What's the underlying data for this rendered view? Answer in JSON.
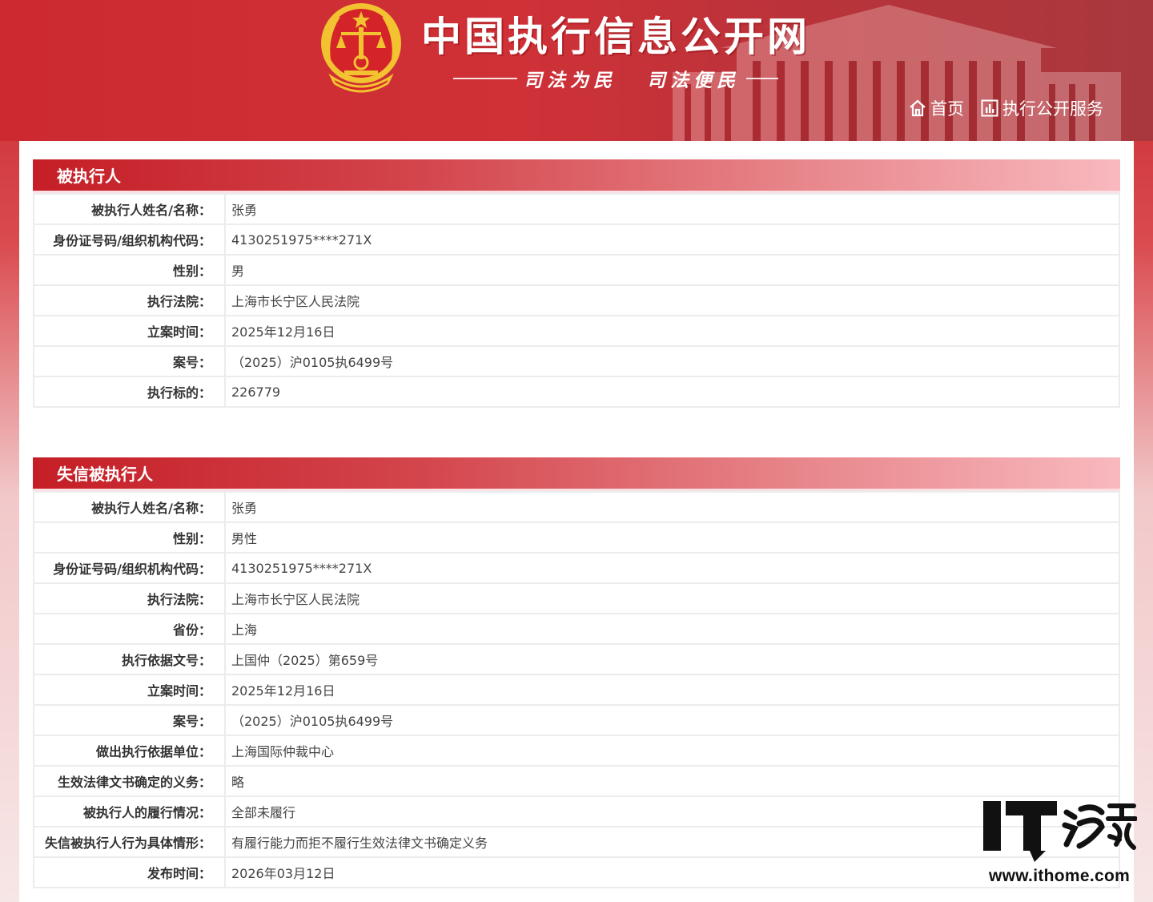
{
  "header": {
    "site_title": "中国执行信息公开网",
    "slogan_1": "司法为民",
    "slogan_2": "司法便民",
    "nav": [
      {
        "label": "首页",
        "icon": "home-icon"
      },
      {
        "label": "执行公开服务",
        "icon": "chart-icon"
      }
    ]
  },
  "colors": {
    "brand_red": "#c6262c",
    "header_gradient_end": "#f8b9be",
    "emblem_gold": "#f2c230"
  },
  "section1": {
    "title": "被执行人",
    "rows": [
      {
        "label": "被执行人姓名/名称：",
        "value": "张勇"
      },
      {
        "label": "身份证号码/组织机构代码：",
        "value": "4130251975****271X"
      },
      {
        "label": "性别：",
        "value": "男"
      },
      {
        "label": "执行法院：",
        "value": "上海市长宁区人民法院"
      },
      {
        "label": "立案时间：",
        "value": "2025年12月16日"
      },
      {
        "label": "案号：",
        "value": "（2025）沪0105执6499号"
      },
      {
        "label": "执行标的：",
        "value": "226779"
      }
    ]
  },
  "section2": {
    "title": "失信被执行人",
    "rows": [
      {
        "label": "被执行人姓名/名称：",
        "value": "张勇"
      },
      {
        "label": "性别：",
        "value": "男性"
      },
      {
        "label": "身份证号码/组织机构代码：",
        "value": "4130251975****271X"
      },
      {
        "label": "执行法院：",
        "value": "上海市长宁区人民法院"
      },
      {
        "label": "省份：",
        "value": "上海"
      },
      {
        "label": "执行依据文号：",
        "value": "上国仲（2025）第659号"
      },
      {
        "label": "立案时间：",
        "value": "2025年12月16日"
      },
      {
        "label": "案号：",
        "value": "（2025）沪0105执6499号"
      },
      {
        "label": "做出执行依据单位：",
        "value": "上海国际仲裁中心"
      },
      {
        "label": "生效法律文书确定的义务：",
        "value": "略"
      },
      {
        "label": "被执行人的履行情况：",
        "value": "全部未履行"
      },
      {
        "label": "失信被执行人行为具体情形：",
        "value": "有履行能力而拒不履行生效法律文书确定义务"
      },
      {
        "label": "发布时间：",
        "value": "2026年03月12日"
      }
    ]
  },
  "watermark": {
    "logo_text": "IT之家",
    "url": "www.ithome.com"
  }
}
